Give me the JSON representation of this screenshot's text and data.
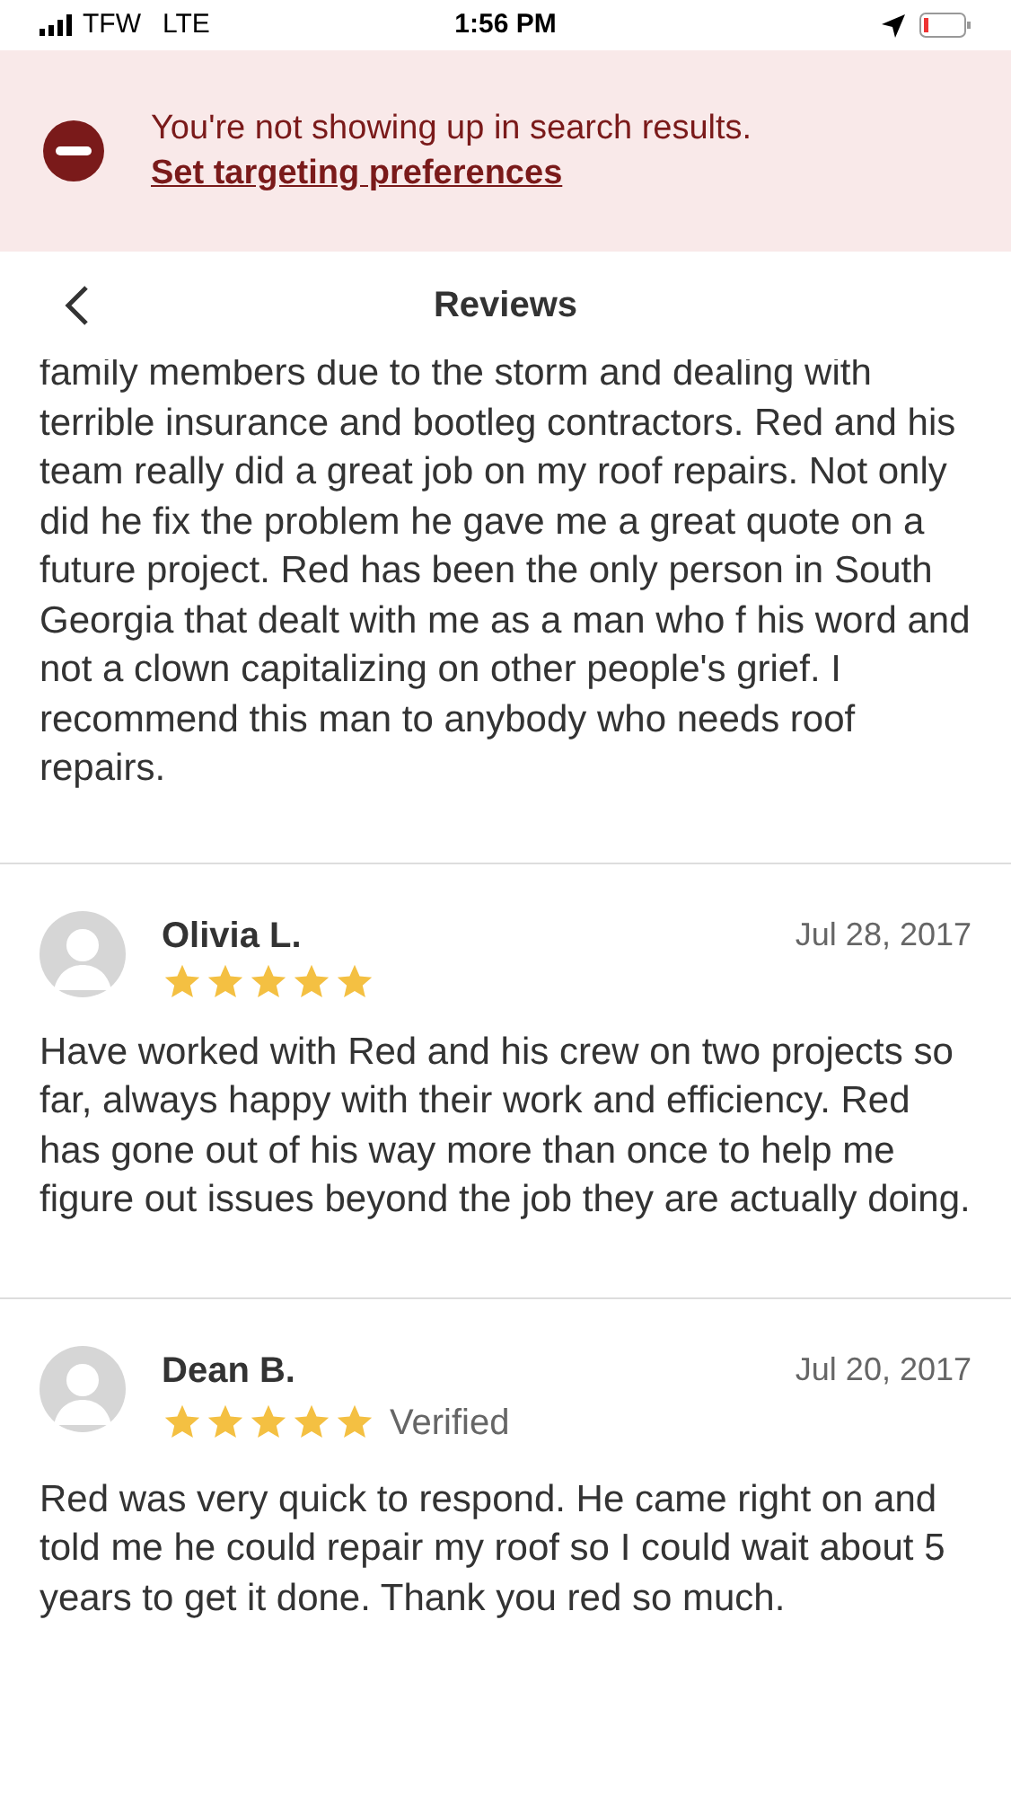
{
  "status_bar": {
    "carrier": "TFW",
    "network": "LTE",
    "time": "1:56 PM"
  },
  "banner": {
    "message": "You're not showing up in search results.",
    "link": "Set targeting preferences"
  },
  "header": {
    "title": "Reviews"
  },
  "reviews": [
    {
      "text": "family members due to the storm and dealing with terrible insurance and bootleg contractors. Red and his team really did a great job on my roof repairs. Not only did he fix the problem he gave me a great quote on a future project. Red has been the only person in South Georgia that dealt with me as a man who f his word and not a clown capitalizing on other people's grief. I recommend this man to anybody who needs roof repairs."
    },
    {
      "name": "Olivia L.",
      "date": "Jul 28, 2017",
      "stars": 5,
      "text": "Have worked with Red and his crew on two projects so far, always happy with their work and efficiency. Red has gone out of his way more than once to help me figure out issues beyond the job they are actually doing."
    },
    {
      "name": "Dean B.",
      "date": "Jul 20, 2017",
      "stars": 5,
      "badge": "Verified",
      "text": "Red was very quick to respond. He came right on and told me he could repair my roof so I could wait about 5 years to get it done. Thank you red so much."
    }
  ]
}
